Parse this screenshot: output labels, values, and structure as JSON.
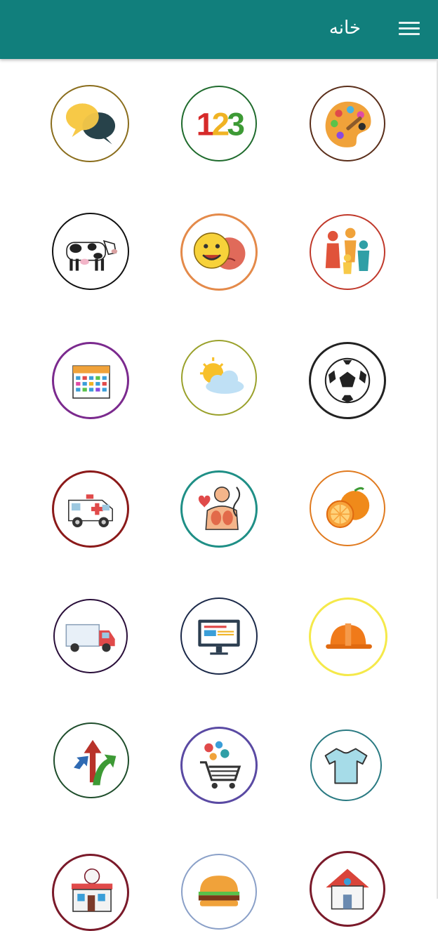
{
  "appbar": {
    "title": "خانه",
    "background": "#117f7c",
    "menu_icon": "hamburger-menu-icon"
  },
  "categories": [
    {
      "name": "speech-bubbles-icon",
      "border": "#8a6d1c"
    },
    {
      "name": "numbers-123-icon",
      "border": "#1f6b2d"
    },
    {
      "name": "paint-palette-icon",
      "border": "#5a2e1a"
    },
    {
      "name": "cow-icon",
      "border": "#111111"
    },
    {
      "name": "emotion-faces-icon",
      "border": "#e48a4a"
    },
    {
      "name": "family-icon",
      "border": "#c0392b"
    },
    {
      "name": "calendar-icon",
      "border": "#7b2a8e"
    },
    {
      "name": "weather-sun-cloud-icon",
      "border": "#9aa12b"
    },
    {
      "name": "soccer-ball-icon",
      "border": "#222222"
    },
    {
      "name": "ambulance-icon",
      "border": "#8b1a1a"
    },
    {
      "name": "human-body-icon",
      "border": "#1f8f86"
    },
    {
      "name": "orange-fruit-icon",
      "border": "#e07a1f"
    },
    {
      "name": "truck-icon",
      "border": "#2a0f3a"
    },
    {
      "name": "computer-monitor-icon",
      "border": "#1c2a4a"
    },
    {
      "name": "hard-hat-icon",
      "border": "#f5e94a"
    },
    {
      "name": "direction-arrows-icon",
      "border": "#1e4d2b"
    },
    {
      "name": "shopping-cart-icon",
      "border": "#5a4aa3"
    },
    {
      "name": "t-shirt-icon",
      "border": "#2a7a82"
    },
    {
      "name": "store-building-icon",
      "border": "#7a1a2a"
    },
    {
      "name": "burger-icon",
      "border": "#8aa0c8"
    },
    {
      "name": "house-icon",
      "border": "#7a1a2a"
    }
  ]
}
